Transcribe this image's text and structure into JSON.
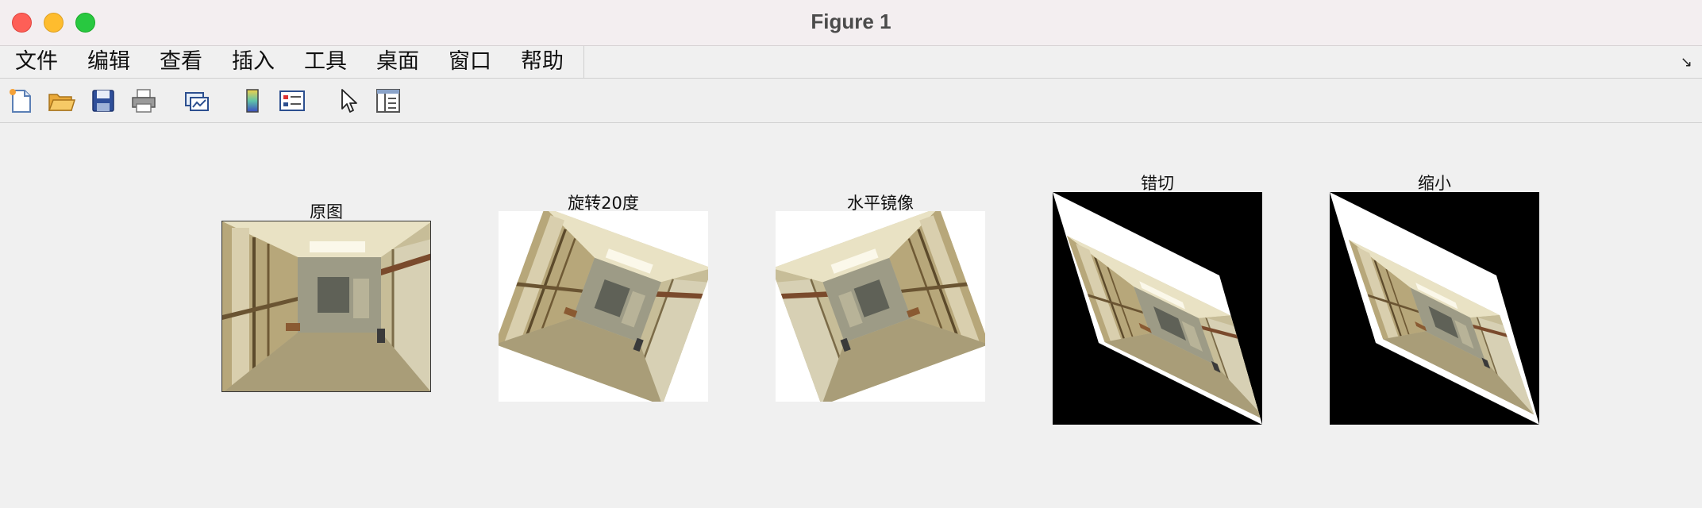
{
  "window": {
    "title": "Figure 1"
  },
  "menu": {
    "items": [
      "文件",
      "编辑",
      "查看",
      "插入",
      "工具",
      "桌面",
      "窗口",
      "帮助"
    ]
  },
  "toolbar": {
    "buttons": [
      "new-figure-icon",
      "open-folder-icon",
      "save-icon",
      "print-icon",
      "link-plot-icon",
      "colorbar-icon",
      "legend-icon",
      "pointer-icon",
      "property-editor-icon"
    ]
  },
  "subplots": [
    {
      "title": "原图"
    },
    {
      "title": "旋转20度"
    },
    {
      "title": "水平镜像"
    },
    {
      "title": "错切"
    },
    {
      "title": "缩小"
    }
  ],
  "colors": {
    "axes_black": "#000000",
    "image_white": "#ffffff",
    "hallway_beige": "#bdb28a"
  }
}
